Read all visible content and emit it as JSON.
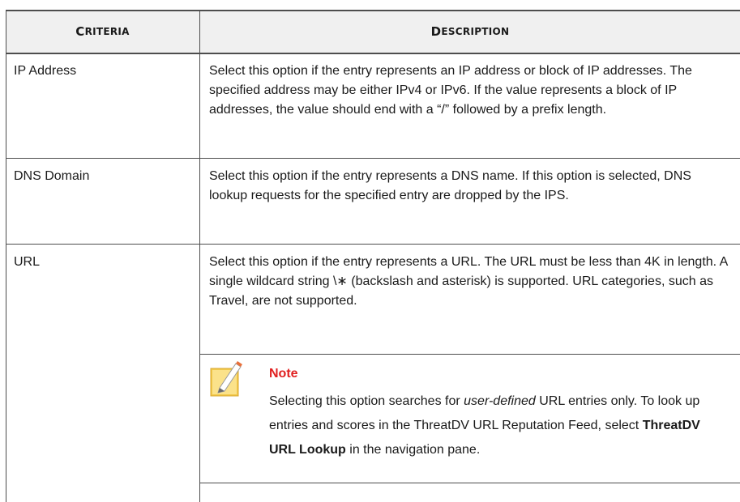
{
  "header": {
    "criteria": {
      "first": "C",
      "rest": "RITERIA"
    },
    "description": {
      "first": "D",
      "rest": "ESCRIPTION"
    }
  },
  "rows": [
    {
      "criteria": "IP Address",
      "description": "Select this option if the entry represents an IP address or block of IP addresses. The specified address may be either IPv4 or IPv6. If the value represents a block of IP addresses, the value should end with a “/” followed by a prefix length."
    },
    {
      "criteria": "DNS Domain",
      "description": "Select this option if the entry represents a DNS name. If this option is selected, DNS lookup requests for the specified entry are dropped by the IPS."
    },
    {
      "criteria": "URL",
      "description": "Select this option if the entry represents a URL. The URL must be less than 4K in length. A single wildcard string \\∗ (backslash and asterisk) is supported. URL categories, such as Travel, are not supported."
    }
  ],
  "note": {
    "title": "Note",
    "body_prefix": "Selecting this option searches for ",
    "body_emphasis": "user-defined",
    "body_middle": " URL entries only. To look up entries and scores in the ThreatDV URL Reputation Feed, select ",
    "body_strong": "ThreatDV URL Lookup",
    "body_suffix": " in the navigation pane.",
    "icon": "note-pencil-icon"
  },
  "colors": {
    "header_bg": "#f0f0f0",
    "rule": "#4d4d4d",
    "note_title": "#e02020",
    "icon_yellow": "#f2c94c"
  }
}
